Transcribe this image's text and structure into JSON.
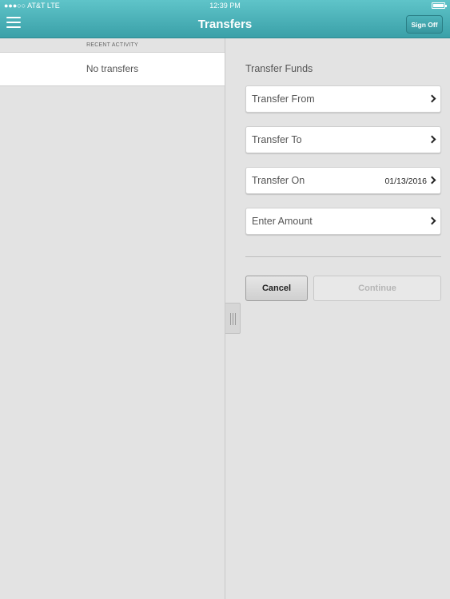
{
  "status_bar": {
    "carrier": "●●●○○ AT&T  LTE",
    "time": "12:39 PM"
  },
  "nav": {
    "title": "Transfers",
    "sign_off_label": "Sign Off"
  },
  "recent_activity": {
    "header": "RECENT ACTIVITY",
    "empty_text": "No transfers"
  },
  "transfer_form": {
    "section_title": "Transfer Funds",
    "fields": [
      {
        "label": "Transfer From",
        "value": ""
      },
      {
        "label": "Transfer To",
        "value": ""
      },
      {
        "label": "Transfer On",
        "value": "01/13/2016"
      },
      {
        "label": "Enter Amount",
        "value": ""
      }
    ],
    "cancel_label": "Cancel",
    "continue_label": "Continue"
  },
  "colors": {
    "nav_bar": "#4db3ba",
    "background": "#e3e3e3",
    "disabled_text": "#b5b5b5"
  },
  "icons": [
    "menu-icon",
    "battery-icon",
    "chevron-right-icon",
    "drag-handle-icon"
  ]
}
